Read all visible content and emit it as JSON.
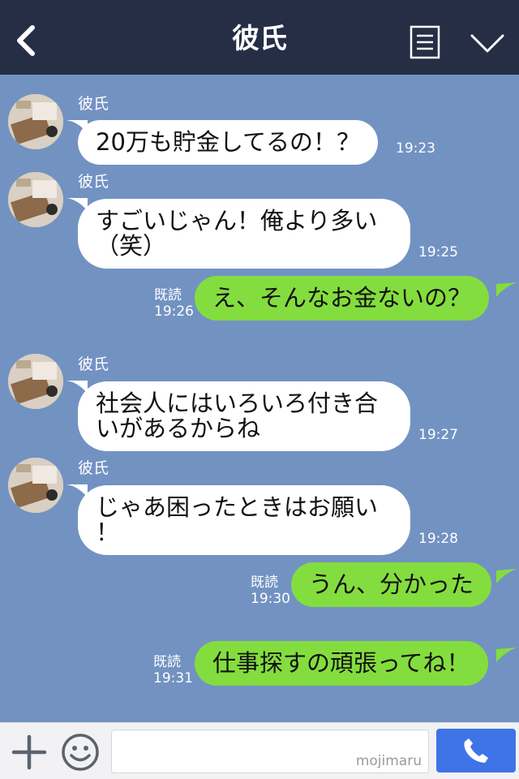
{
  "header": {
    "title": "彼氏",
    "back_icon": "chevron-left-icon",
    "menu_icon": "list-icon",
    "collapse_icon": "chevron-down-icon",
    "background": "#252e45"
  },
  "chat": {
    "background": "#7292c2",
    "messages": [
      {
        "direction": "in",
        "sender": "彼氏",
        "text": "20万も貯金してるの！？",
        "time": "19:23"
      },
      {
        "direction": "in",
        "sender": "彼氏",
        "lines": [
          "すごいじゃん！俺より多い",
          "（笑）"
        ],
        "time": "19:25"
      },
      {
        "direction": "out",
        "read": "既読",
        "text": "え、そんなお金ないの？",
        "time": "19:26"
      },
      {
        "direction": "in",
        "sender": "彼氏",
        "lines": [
          "社会人にはいろいろ付き合",
          "いがあるからね"
        ],
        "time": "19:27"
      },
      {
        "direction": "in",
        "sender": "彼氏",
        "lines": [
          "じゃあ困ったときはお願い",
          "！"
        ],
        "time": "19:28"
      },
      {
        "direction": "out",
        "read": "既読",
        "text": "うん、分かった",
        "time": "19:30"
      },
      {
        "direction": "out",
        "read": "既読",
        "text": "仕事探すの頑張ってね！",
        "time": "19:31"
      }
    ]
  },
  "footer": {
    "plus_icon": "plus-icon",
    "sticker_icon": "smile-icon",
    "watermark": "mojimaru",
    "call_icon": "phone-icon",
    "call_color": "#3f74e6"
  },
  "colors": {
    "outgoing_bubble": "#84dd3e",
    "incoming_bubble": "#ffffff"
  }
}
